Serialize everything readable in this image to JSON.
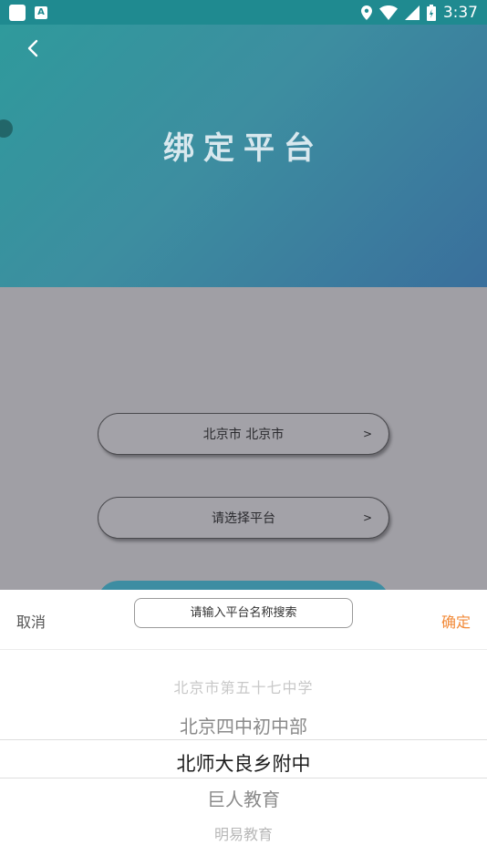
{
  "status_bar": {
    "time": "3:37"
  },
  "header": {
    "title": "绑定平台"
  },
  "form": {
    "region_label": "北京市 北京市",
    "platform_label": "请选择平台",
    "chevron": ">"
  },
  "sheet": {
    "cancel_label": "取消",
    "confirm_label": "确定",
    "search_placeholder": "请输入平台名称搜索",
    "options": [
      "北京市第五十七中学",
      "北京四中初中部",
      "北师大良乡附中",
      "巨人教育",
      "明易教育"
    ],
    "selected_index": 2
  },
  "colors": {
    "accent": "#f28a38",
    "header_start": "#2f9a9c",
    "header_end": "#3a6f9c",
    "overlay": "#a09fa5"
  }
}
